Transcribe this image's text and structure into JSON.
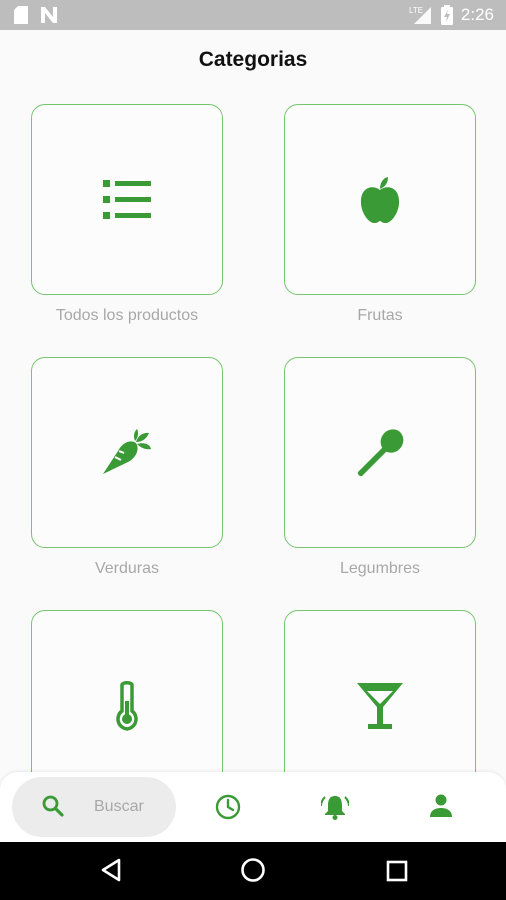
{
  "status_bar": {
    "time": "2:26",
    "network_label": "LTE",
    "icons": [
      "sd-card-icon",
      "n-notification-icon",
      "signal-icon",
      "battery-icon"
    ]
  },
  "header": {
    "title": "Categorias"
  },
  "categories": [
    {
      "label": "Todos los productos",
      "icon": "list-icon"
    },
    {
      "label": "Frutas",
      "icon": "apple-icon"
    },
    {
      "label": "Verduras",
      "icon": "carrot-icon"
    },
    {
      "label": "Legumbres",
      "icon": "spoon-icon"
    },
    {
      "label": "",
      "icon": "thermometer-icon"
    },
    {
      "label": "",
      "icon": "cocktail-glass-icon"
    }
  ],
  "bottom_nav": {
    "search_label": "Buscar",
    "items": [
      "search-icon",
      "history-clock-icon",
      "notifications-bell-icon",
      "profile-person-icon"
    ]
  },
  "system_nav": [
    "back-icon",
    "home-icon",
    "recents-icon"
  ],
  "colors": {
    "accent": "#3a9a35",
    "tile_border": "#76c56f",
    "label_gray": "#a8a8a8",
    "status_bar": "#bdbdbd"
  }
}
